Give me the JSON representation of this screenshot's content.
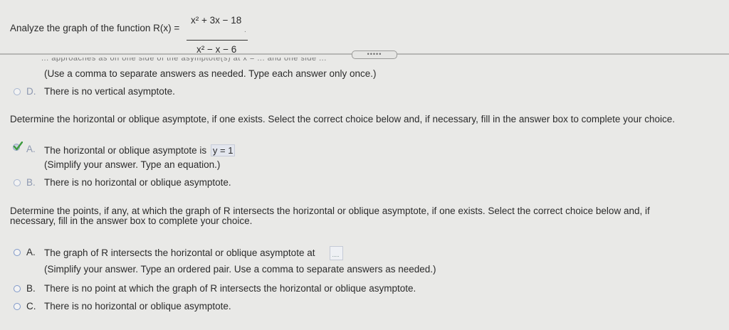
{
  "header": {
    "prompt": "Analyze the graph of the function R(x) =",
    "numerator": "x² + 3x − 18",
    "denominator": "x² − x − 6",
    "trailing_dot": "."
  },
  "divider": {
    "handle_label": "•••••"
  },
  "truncated_line": "... approaches as on one side of the asymptote(s) at x = ... and one side ...",
  "vertical": {
    "instruction": "(Use a comma to separate answers as needed. Type each answer only once.)",
    "option_d": {
      "letter": "D.",
      "text": "There is no vertical asymptote."
    }
  },
  "horizontal": {
    "question": "Determine the horizontal or oblique asymptote, if one exists. Select the correct choice below and, if necessary, fill in the answer box to complete your choice.",
    "option_a": {
      "letter": "A.",
      "text": "The horizontal or oblique asymptote is",
      "answer": "y = 1",
      "note": "(Simplify your answer. Type an equation.)"
    },
    "option_b": {
      "letter": "B.",
      "text": "There is no horizontal or oblique asymptote."
    }
  },
  "intersect": {
    "question_line1": "Determine the points, if any, at which the graph of R intersects the horizontal or oblique asymptote, if one exists. Select the correct choice below and, if",
    "question_line2": "necessary, fill in the answer box to complete your choice.",
    "option_a": {
      "letter": "A.",
      "text": "The graph of R intersects the horizontal or oblique asymptote at",
      "note": "(Simplify your answer. Type an ordered pair. Use a comma to separate answers as needed.)"
    },
    "option_b": {
      "letter": "B.",
      "text": "There is no point at which the graph of R intersects the horizontal or oblique asymptote."
    },
    "option_c": {
      "letter": "C.",
      "text": "There is no horizontal or oblique asymptote."
    }
  },
  "colors": {
    "radio_border": "#7f98c9",
    "check_green": "#3c9a3c",
    "background": "#e9e9e7"
  }
}
